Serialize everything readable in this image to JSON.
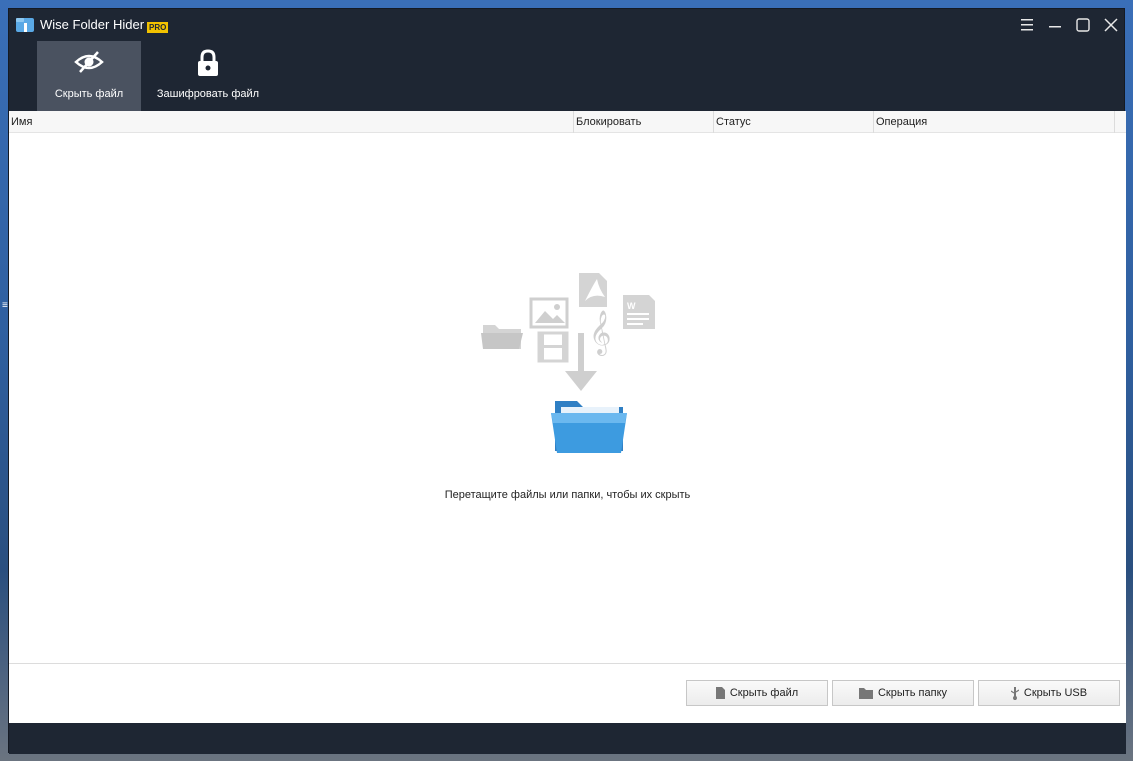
{
  "app": {
    "title": "Wise Folder Hider",
    "badge": "PRO"
  },
  "window_controls": [
    "menu-icon",
    "minimize-icon",
    "maximize-icon",
    "close-icon"
  ],
  "toolbar": {
    "items": [
      {
        "label": "Скрыть файл",
        "icon": "eye-hidden-icon",
        "active": true
      },
      {
        "label": "Зашифровать файл",
        "icon": "lock-icon",
        "active": false
      }
    ]
  },
  "table": {
    "columns": [
      "Имя",
      "Блокировать",
      "Статус",
      "Операция"
    ],
    "rows": []
  },
  "drop_zone": {
    "hint": "Перетащите файлы или папки, чтобы их скрыть",
    "icons": [
      "folder-icon",
      "image-icon",
      "pdf-icon",
      "video-icon",
      "music-icon",
      "document-icon",
      "arrow-down-icon",
      "blue-folder-icon"
    ]
  },
  "footer": {
    "hide_file": "Скрыть файл",
    "hide_folder": "Скрыть папку",
    "hide_usb": "Скрыть USB"
  },
  "colors": {
    "titlebar": "#1e2633",
    "active_tab": "#4a5260",
    "badge": "#f2c200",
    "folder_blue": "#3d9be0"
  }
}
